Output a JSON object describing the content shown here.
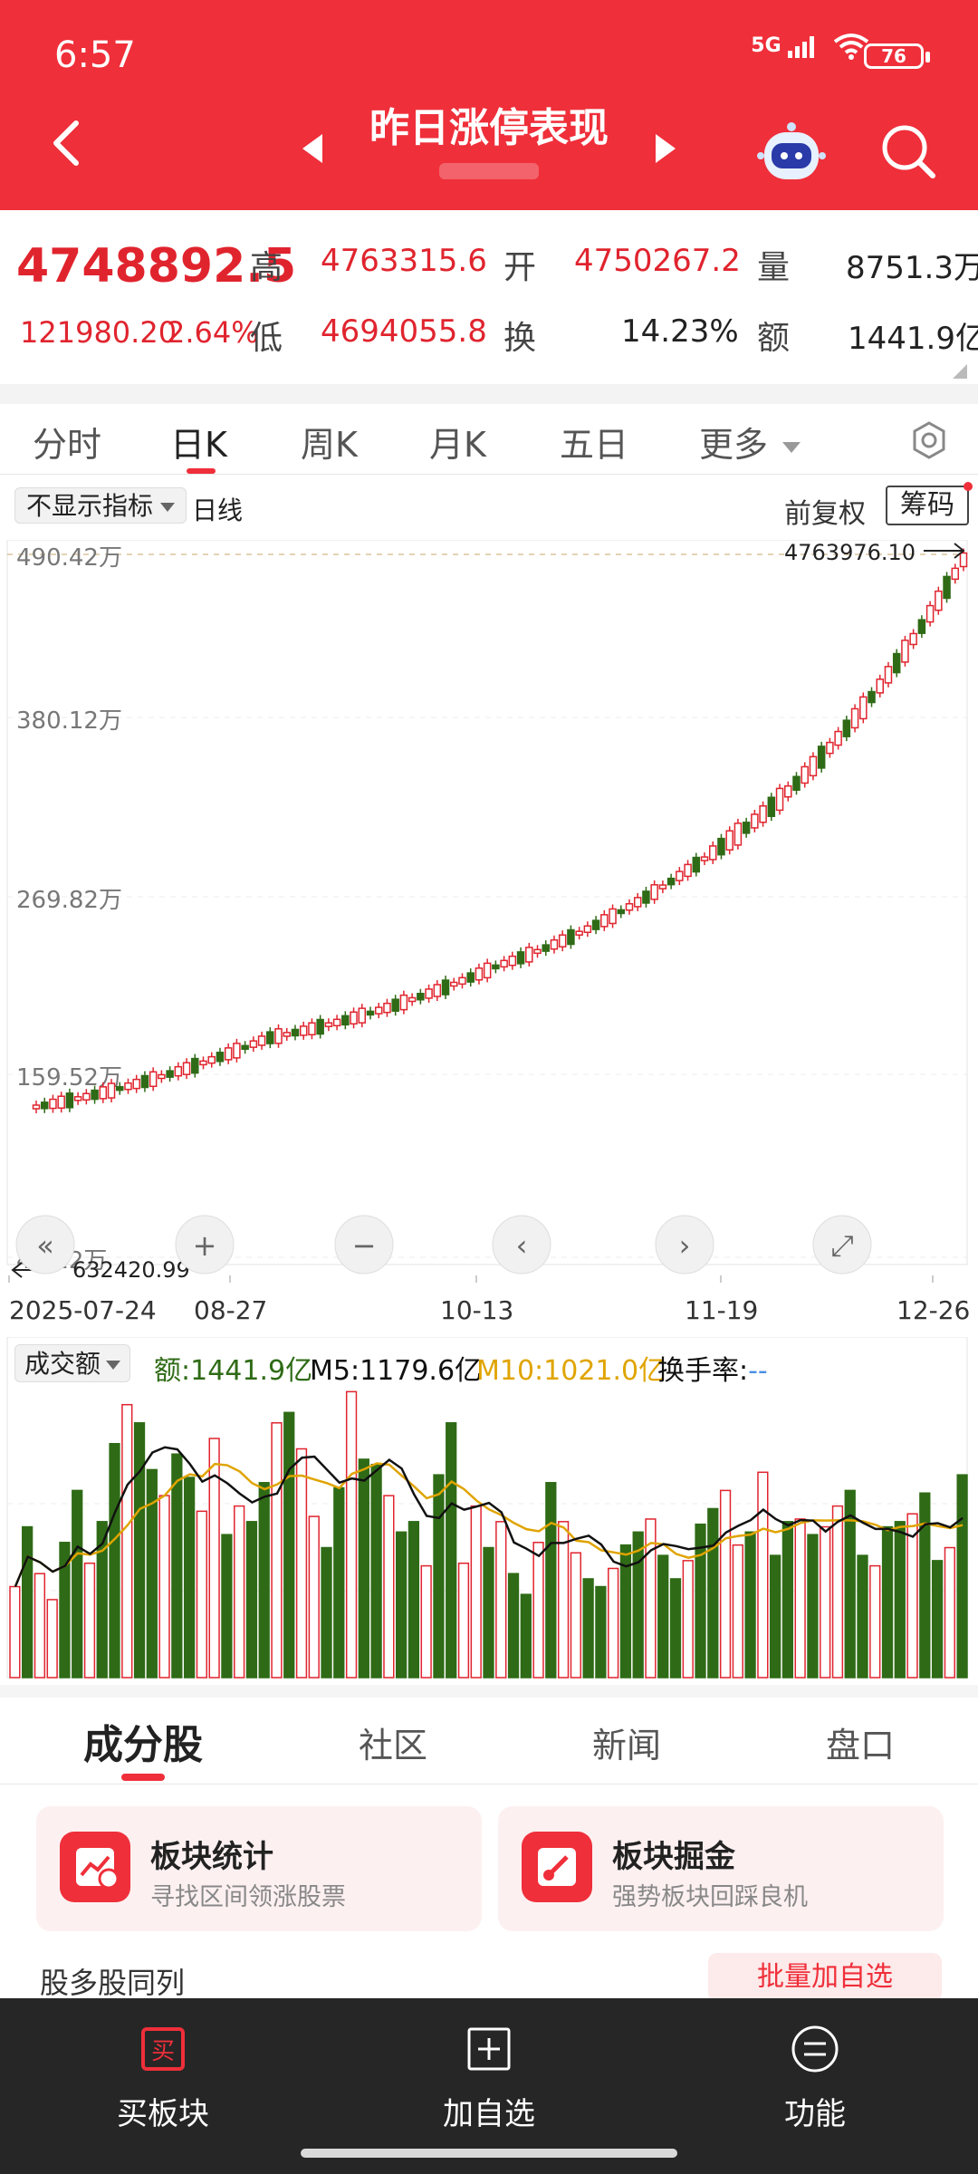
{
  "status_bar": {
    "time": "6:57",
    "network": "5G",
    "battery": "76"
  },
  "nav": {
    "title": "昨日涨停表现",
    "subtitle": ""
  },
  "quote": {
    "price": "4748892.5",
    "change": "121980.20",
    "change_pct": "2.64%",
    "high_label": "高",
    "high": "4763315.6",
    "open_label": "开",
    "open": "4750267.2",
    "vol_label": "量",
    "vol": "8751.3万",
    "low_label": "低",
    "low": "4694055.8",
    "turn_label": "换",
    "turn": "14.23%",
    "amt_label": "额",
    "amt": "1441.9亿"
  },
  "tabs": [
    "分时",
    "日K",
    "周K",
    "月K",
    "五日",
    "更多"
  ],
  "toolbar": {
    "indicator": "不显示指标",
    "line_type": "日线",
    "adjust": "前复权",
    "chip": "筹码"
  },
  "controls": [
    "«",
    "+",
    "−",
    "‹",
    "›",
    "⤢"
  ],
  "kline": {
    "y_labels": [
      "490.42万",
      "380.12万",
      "269.82万",
      "159.52万",
      "49.22万"
    ],
    "max_label": "4763976.10",
    "min_label": "632420.99",
    "x_labels": [
      "2025-07-24",
      "08-27",
      "10-13",
      "11-19",
      "12-26"
    ]
  },
  "volume_legend": {
    "select": "成交额",
    "amount_label": "额:",
    "amount": "1441.9亿",
    "m5_label": "M5:",
    "m5": "1179.6亿",
    "m10_label": "M10:",
    "m10": "1021.0亿",
    "turnover_label": "换手率:",
    "turnover": "--"
  },
  "section_tabs": [
    "成分股",
    "社区",
    "新闻",
    "盘口"
  ],
  "cards": [
    {
      "title": "板块统计",
      "subtitle": "寻找区间领涨股票"
    },
    {
      "title": "板块掘金",
      "subtitle": "强势板块回踩良机"
    }
  ],
  "peek": {
    "text": "股多股同列",
    "button": "批量加自选"
  },
  "bottom_tabs": [
    {
      "label": "买板块",
      "icon": "buy-icon"
    },
    {
      "label": "加自选",
      "icon": "add-watch-icon"
    },
    {
      "label": "功能",
      "icon": "menu-icon"
    }
  ],
  "colors": {
    "brand": "#ef2f3a",
    "up": "#e0242e",
    "down": "#2f6b16",
    "ma5": "#111111",
    "ma10": "#e0a400"
  },
  "chart_data": [
    {
      "type": "candlestick",
      "title": "",
      "ylabel": "",
      "ylim": [
        492200,
        4904200
      ],
      "x": [
        "2025-07-24",
        "08-27",
        "10-13",
        "11-19",
        "12-26"
      ],
      "close_trend": [
        632420.99,
        1150000,
        1700000,
        2650000,
        4748892.5
      ],
      "max": 4763976.1,
      "min": 632420.99
    },
    {
      "type": "bar",
      "title": "成交额",
      "series": [
        {
          "name": "额",
          "values": [
            35,
            58,
            40,
            30,
            52,
            72,
            44,
            60,
            90,
            105,
            98,
            80,
            70,
            86,
            77,
            64,
            92,
            55,
            66,
            60,
            75,
            98,
            102,
            88,
            62,
            50,
            73,
            110,
            84,
            82,
            70,
            56,
            60,
            43,
            78,
            98,
            44,
            66,
            50,
            60,
            40,
            32,
            52,
            75,
            60,
            48,
            38,
            35,
            42,
            51,
            56,
            61,
            47,
            38,
            45,
            59,
            65,
            72,
            51,
            56,
            79,
            47,
            60,
            61,
            55,
            58,
            66,
            72,
            47,
            43,
            58,
            60,
            63,
            71,
            45,
            50,
            78
          ]
        },
        {
          "name": "M5",
          "value": "1179.6亿"
        },
        {
          "name": "M10",
          "value": "1021.0亿"
        }
      ]
    }
  ]
}
